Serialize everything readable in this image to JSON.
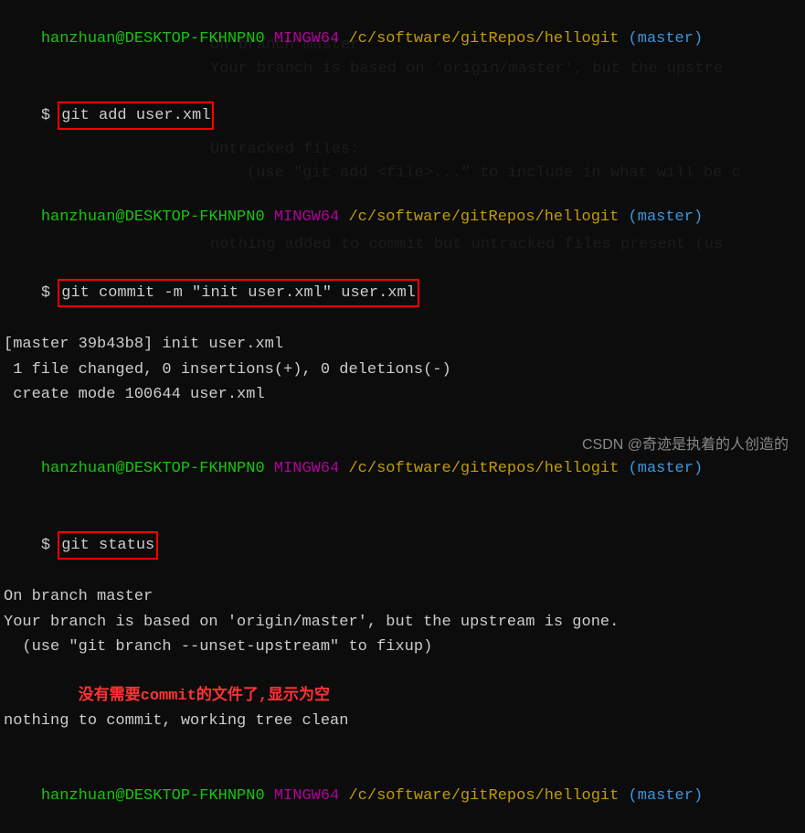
{
  "prompt1": {
    "user": "hanzhuan@DESKTOP-FKHNPN0",
    "mingw": "MINGW64",
    "path": "/c/software/gitRepos/hellogit",
    "branch": "(master)",
    "symbol": "$ ",
    "cmd": "git add user.xml"
  },
  "spacer1": " ",
  "prompt2": {
    "user": "hanzhuan@DESKTOP-FKHNPN0",
    "mingw": "MINGW64",
    "path": "/c/software/gitRepos/hellogit",
    "branch": "(master)",
    "symbol": "$ ",
    "cmd": "git commit -m \"init user.xml\" user.xml"
  },
  "out2_l1": "[master 39b43b8] init user.xml",
  "out2_l2": " 1 file changed, 0 insertions(+), 0 deletions(-)",
  "out2_l3": " create mode 100644 user.xml",
  "spacer2": " ",
  "prompt3": {
    "user": "hanzhuan@DESKTOP-FKHNPN0",
    "mingw": "MINGW64",
    "path": "/c/software/gitRepos/hellogit",
    "branch": "(master)",
    "symbol": "$ ",
    "cmd": "git status"
  },
  "out3_l1": "On branch master",
  "out3_l2": "Your branch is based on 'origin/master', but the upstream is gone.",
  "out3_l3": "  (use \"git branch --unset-upstream\" to fixup)",
  "spacer3": " ",
  "annotation": "        没有需要commit的文件了,显示为空",
  "out3_l4": "nothing to commit, working tree clean",
  "spacer4": " ",
  "prompt4": {
    "user": "hanzhuan@DESKTOP-FKHNPN0",
    "mingw": "MINGW64",
    "path": "/c/software/gitRepos/hellogit",
    "branch": "(master)"
  },
  "watermark": "CSDN @奇迹是执着的人创造的"
}
